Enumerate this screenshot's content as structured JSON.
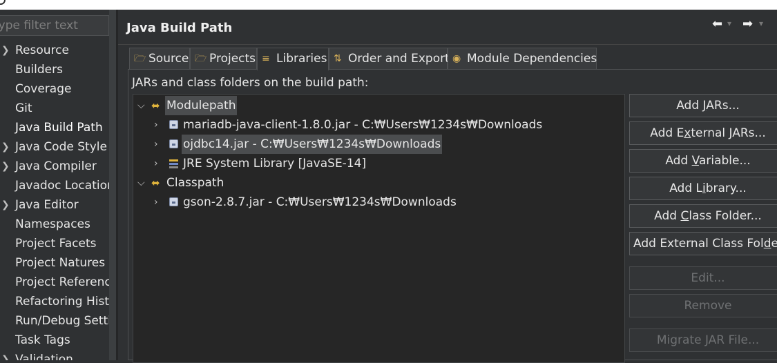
{
  "filter": {
    "placeholder": "type filter text"
  },
  "nav": {
    "items": [
      {
        "label": "Resource",
        "expandable": true
      },
      {
        "label": "Builders",
        "expandable": false
      },
      {
        "label": "Coverage",
        "expandable": false
      },
      {
        "label": "Git",
        "expandable": false
      },
      {
        "label": "Java Build Path",
        "expandable": false,
        "selected": true
      },
      {
        "label": "Java Code Style",
        "expandable": true
      },
      {
        "label": "Java Compiler",
        "expandable": true
      },
      {
        "label": "Javadoc Location",
        "expandable": false
      },
      {
        "label": "Java Editor",
        "expandable": true
      },
      {
        "label": "Namespaces",
        "expandable": false
      },
      {
        "label": "Project Facets",
        "expandable": false
      },
      {
        "label": "Project Natures",
        "expandable": false
      },
      {
        "label": "Project References",
        "expandable": false
      },
      {
        "label": "Refactoring History",
        "expandable": false
      },
      {
        "label": "Run/Debug Settings",
        "expandable": false
      },
      {
        "label": "Task Tags",
        "expandable": false
      },
      {
        "label": "Validation",
        "expandable": true
      }
    ]
  },
  "page": {
    "title": "Java Build Path"
  },
  "tabs": [
    {
      "label": "Source",
      "icon": "source-folder-icon"
    },
    {
      "label": "Projects",
      "icon": "projects-folder-icon"
    },
    {
      "label": "Libraries",
      "icon": "libraries-icon",
      "active": true
    },
    {
      "label": "Order and Export",
      "icon": "order-export-icon"
    },
    {
      "label": "Module Dependencies",
      "icon": "module-icon"
    }
  ],
  "libraries": {
    "section_label": "JARs and class folders on the build path:",
    "modulepath": {
      "label": "Modulepath",
      "entries": [
        {
          "label": "mariadb-java-client-1.8.0.jar - C:₩Users₩1234s₩Downloads",
          "icon": "jar-icon"
        },
        {
          "label": "ojdbc14.jar - C:₩Users₩1234s₩Downloads",
          "icon": "jar-icon",
          "selected": true
        },
        {
          "label": "JRE System Library [JavaSE-14]",
          "icon": "library-icon"
        }
      ]
    },
    "classpath": {
      "label": "Classpath",
      "entries": [
        {
          "label": "gson-2.8.7.jar - C:₩Users₩1234s₩Downloads",
          "icon": "jar-icon"
        }
      ]
    }
  },
  "buttons": {
    "add_jars": {
      "pre": "Add ",
      "u": "J",
      "post": "ARs..."
    },
    "add_external_jars": {
      "pre": "Add E",
      "u": "x",
      "post": "ternal JARs..."
    },
    "add_variable": {
      "pre": "Add ",
      "u": "V",
      "post": "ariable..."
    },
    "add_library": {
      "pre": "Add L",
      "u": "i",
      "post": "brary..."
    },
    "add_class_folder": {
      "pre": "Add ",
      "u": "C",
      "post": "lass Folder..."
    },
    "add_external_class_folder": {
      "pre": "Add External Class Fol",
      "u": "d",
      "post": "er..."
    },
    "edit": "Edit...",
    "remove": "Remove",
    "migrate": "Migrate JAR File..."
  }
}
